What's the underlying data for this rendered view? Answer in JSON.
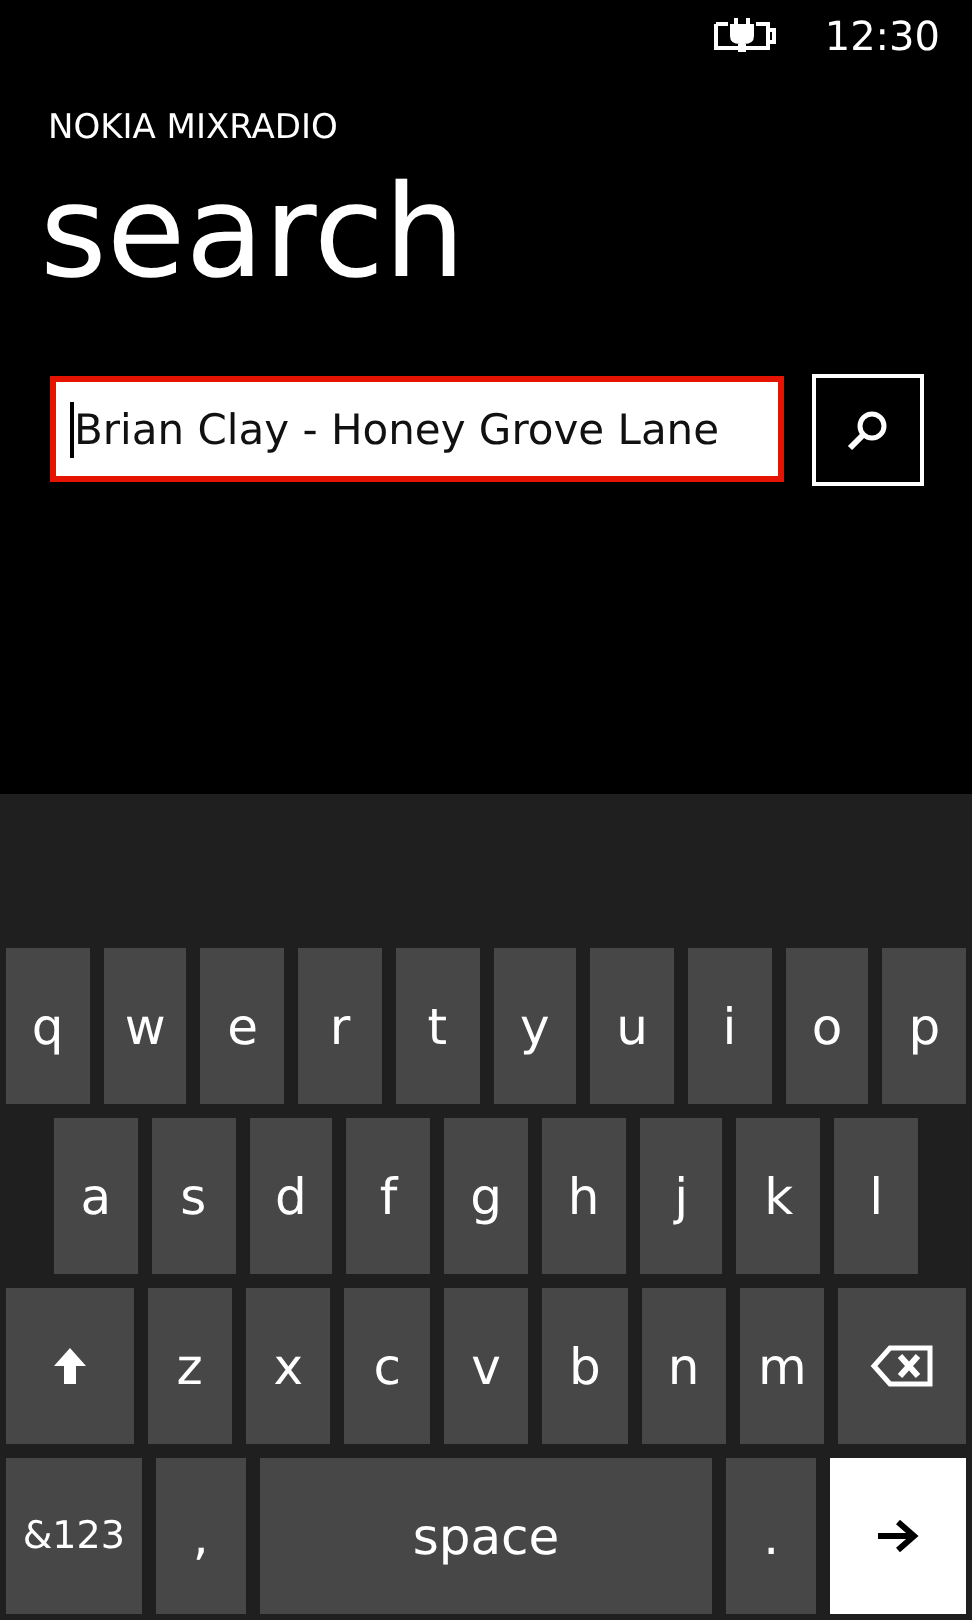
{
  "status_bar": {
    "time": "12:30"
  },
  "app_title": "NOKIA MIXRADIO",
  "page_title": "search",
  "search": {
    "value": "Brian Clay - Honey Grove Lane",
    "focused": true
  },
  "keyboard": {
    "rows": [
      {
        "keys": [
          {
            "kind": "letter",
            "label": "q"
          },
          {
            "kind": "letter",
            "label": "w"
          },
          {
            "kind": "letter",
            "label": "e"
          },
          {
            "kind": "letter",
            "label": "r"
          },
          {
            "kind": "letter",
            "label": "t"
          },
          {
            "kind": "letter",
            "label": "y"
          },
          {
            "kind": "letter",
            "label": "u"
          },
          {
            "kind": "letter",
            "label": "i"
          },
          {
            "kind": "letter",
            "label": "o"
          },
          {
            "kind": "letter",
            "label": "p"
          }
        ]
      },
      {
        "keys": [
          {
            "kind": "letter",
            "label": "a"
          },
          {
            "kind": "letter",
            "label": "s"
          },
          {
            "kind": "letter",
            "label": "d"
          },
          {
            "kind": "letter",
            "label": "f"
          },
          {
            "kind": "letter",
            "label": "g"
          },
          {
            "kind": "letter",
            "label": "h"
          },
          {
            "kind": "letter",
            "label": "j"
          },
          {
            "kind": "letter",
            "label": "k"
          },
          {
            "kind": "letter",
            "label": "l"
          }
        ]
      },
      {
        "keys": [
          {
            "kind": "shift"
          },
          {
            "kind": "letter",
            "label": "z"
          },
          {
            "kind": "letter",
            "label": "x"
          },
          {
            "kind": "letter",
            "label": "c"
          },
          {
            "kind": "letter",
            "label": "v"
          },
          {
            "kind": "letter",
            "label": "b"
          },
          {
            "kind": "letter",
            "label": "n"
          },
          {
            "kind": "letter",
            "label": "m"
          },
          {
            "kind": "backspace"
          }
        ]
      },
      {
        "keys": [
          {
            "kind": "symbols",
            "label": "&123"
          },
          {
            "kind": "letter",
            "label": ","
          },
          {
            "kind": "space",
            "label": "space"
          },
          {
            "kind": "letter",
            "label": "."
          },
          {
            "kind": "enter"
          }
        ]
      }
    ]
  }
}
